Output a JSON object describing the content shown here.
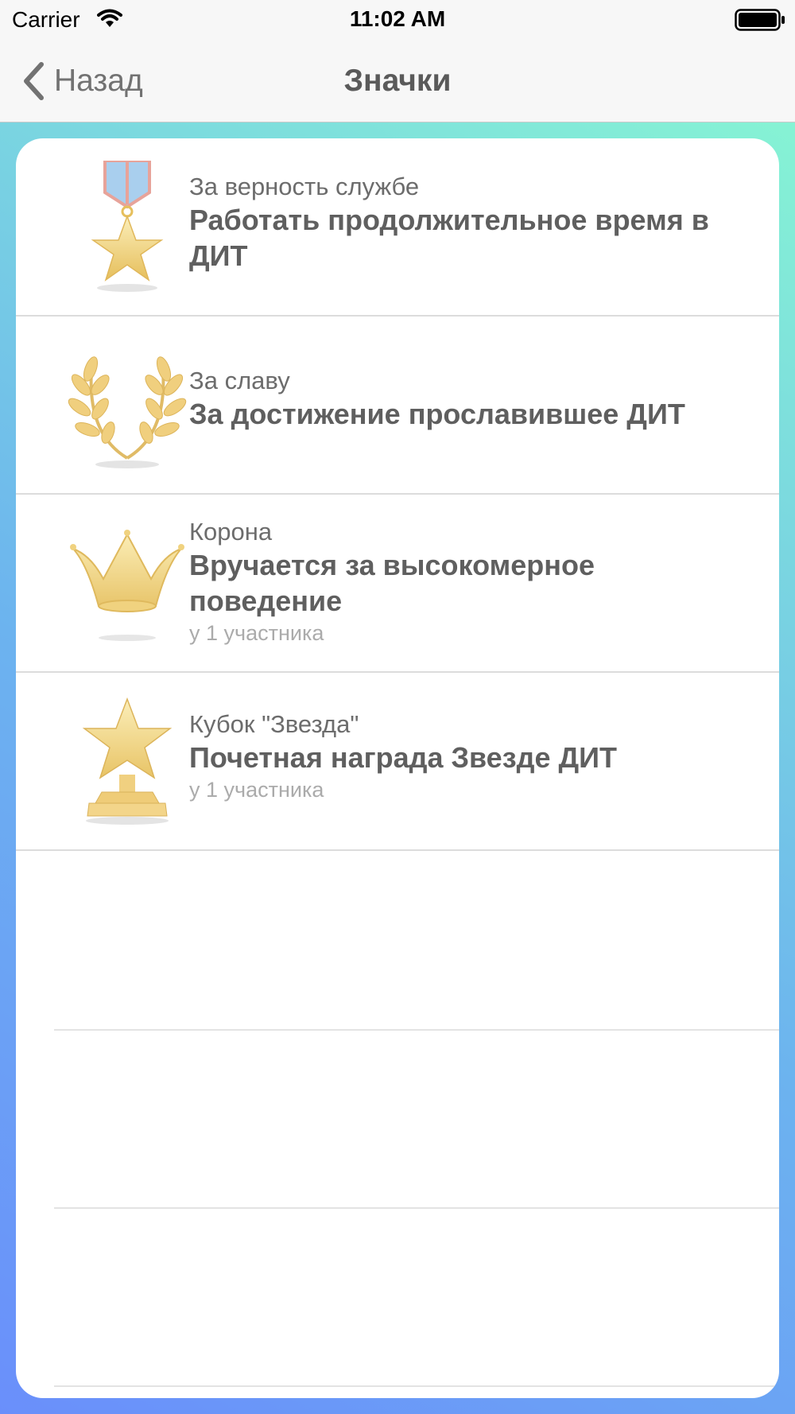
{
  "status_bar": {
    "carrier": "Carrier",
    "time": "11:02 AM"
  },
  "nav": {
    "back_label": "Назад",
    "title": "Значки"
  },
  "badges": [
    {
      "title": "За верность службе",
      "description": "Работать продолжительное время в ДИТ",
      "count": "",
      "icon": "medal-star-icon"
    },
    {
      "title": "За славу",
      "description": "За достижение прославившее ДИТ",
      "count": "",
      "icon": "laurel-wreath-icon"
    },
    {
      "title": "Корона",
      "description": "Вручается за высокомерное поведение",
      "count": "у 1 участника",
      "icon": "crown-icon"
    },
    {
      "title": "Кубок \"Звезда\"",
      "description": "Почетная награда Звезде ДИТ",
      "count": "у 1 участника",
      "icon": "star-trophy-icon"
    }
  ],
  "colors": {
    "gold": "#f2d27a",
    "ribbon": "#8fc3f2",
    "gradient_start": "#6a8ffb",
    "gradient_end": "#86f3d4"
  }
}
